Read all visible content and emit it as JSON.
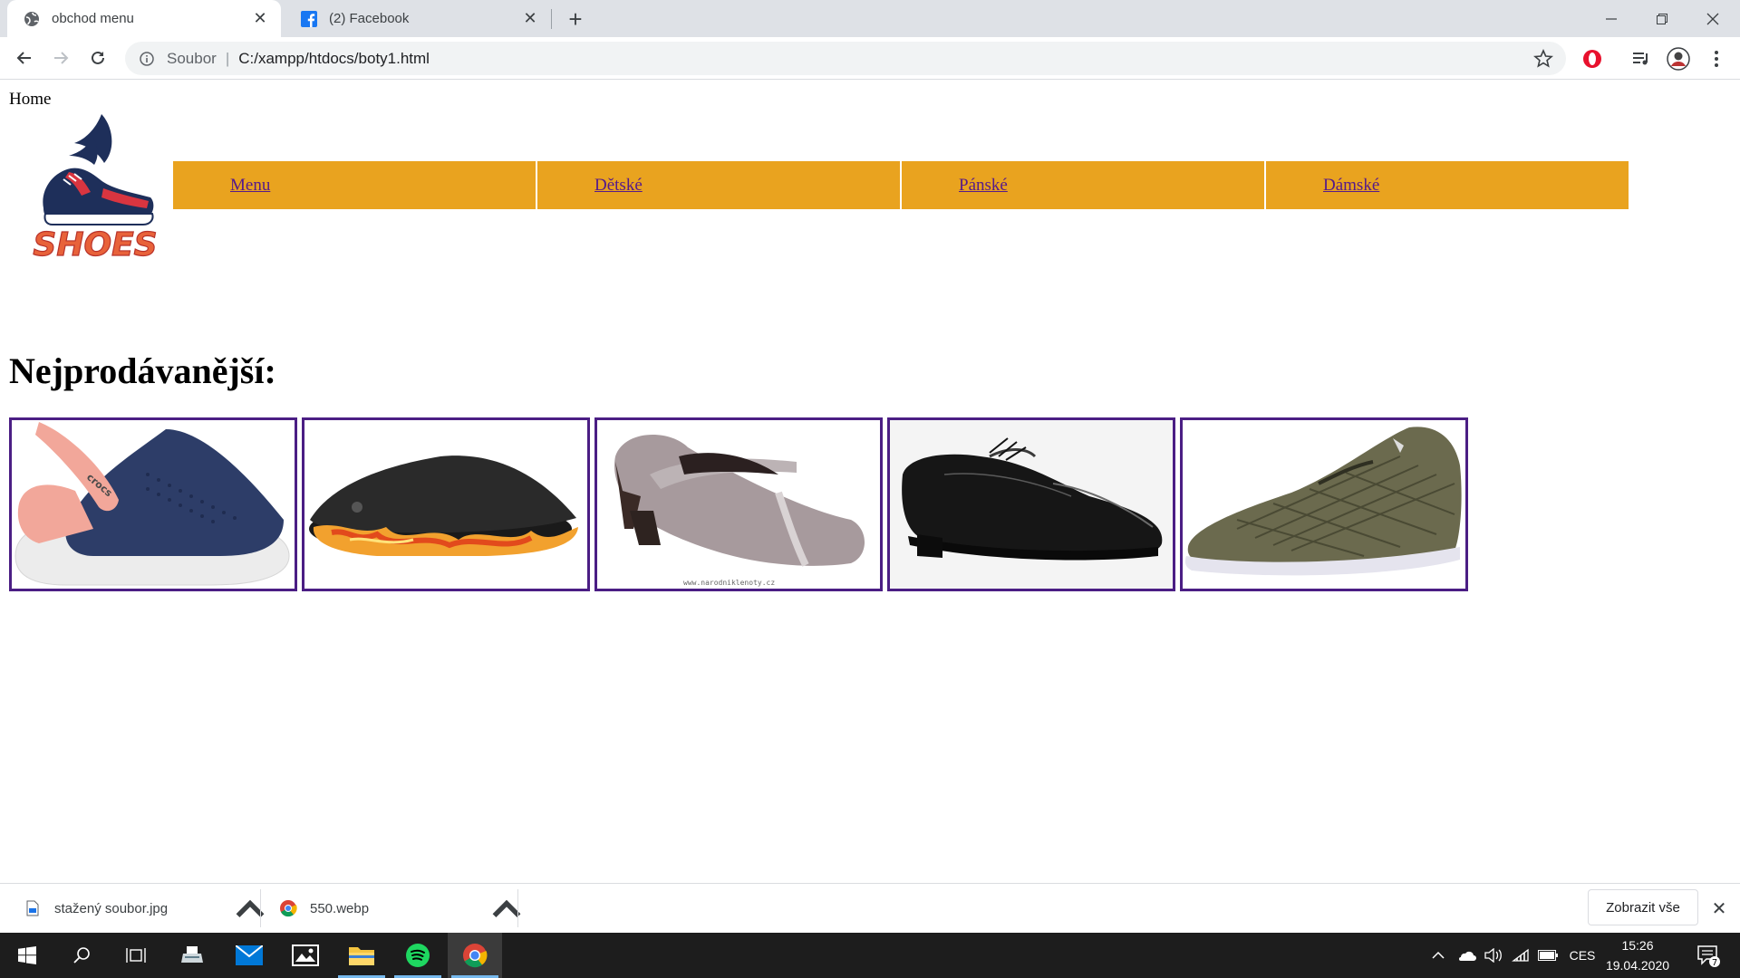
{
  "browser": {
    "tabs": [
      {
        "title": "obchod menu",
        "active": true,
        "icon": "globe-icon"
      },
      {
        "title": "(2) Facebook",
        "active": false,
        "icon": "facebook-icon"
      }
    ],
    "address": {
      "scheme_label": "Soubor",
      "url": "C:/xampp/htdocs/boty1.html"
    }
  },
  "page": {
    "home_link": "Home",
    "logo_text": "SHOES",
    "menu": [
      {
        "label": "Menu"
      },
      {
        "label": "Dětské"
      },
      {
        "label": "Pánské"
      },
      {
        "label": "Dámské"
      }
    ],
    "menu_color": "#e9a31f",
    "heading": "Nejprodávanější:",
    "products": [
      {
        "name": "croc-clog-navy-pink"
      },
      {
        "name": "flame-clog"
      },
      {
        "name": "grey-mary-jane-heel"
      },
      {
        "name": "black-leather-derby"
      },
      {
        "name": "olive-knit-sneaker"
      }
    ],
    "product_watermark": "www.narodniklenoty.cz"
  },
  "downloads": {
    "items": [
      {
        "name": "stažený soubor.jpg",
        "icon": "image-file-icon"
      },
      {
        "name": "550.webp",
        "icon": "chrome-file-icon"
      }
    ],
    "show_all_label": "Zobrazit vše"
  },
  "taskbar": {
    "language": "CES",
    "time": "15:26",
    "date": "19.04.2020",
    "notification_count": "7"
  }
}
